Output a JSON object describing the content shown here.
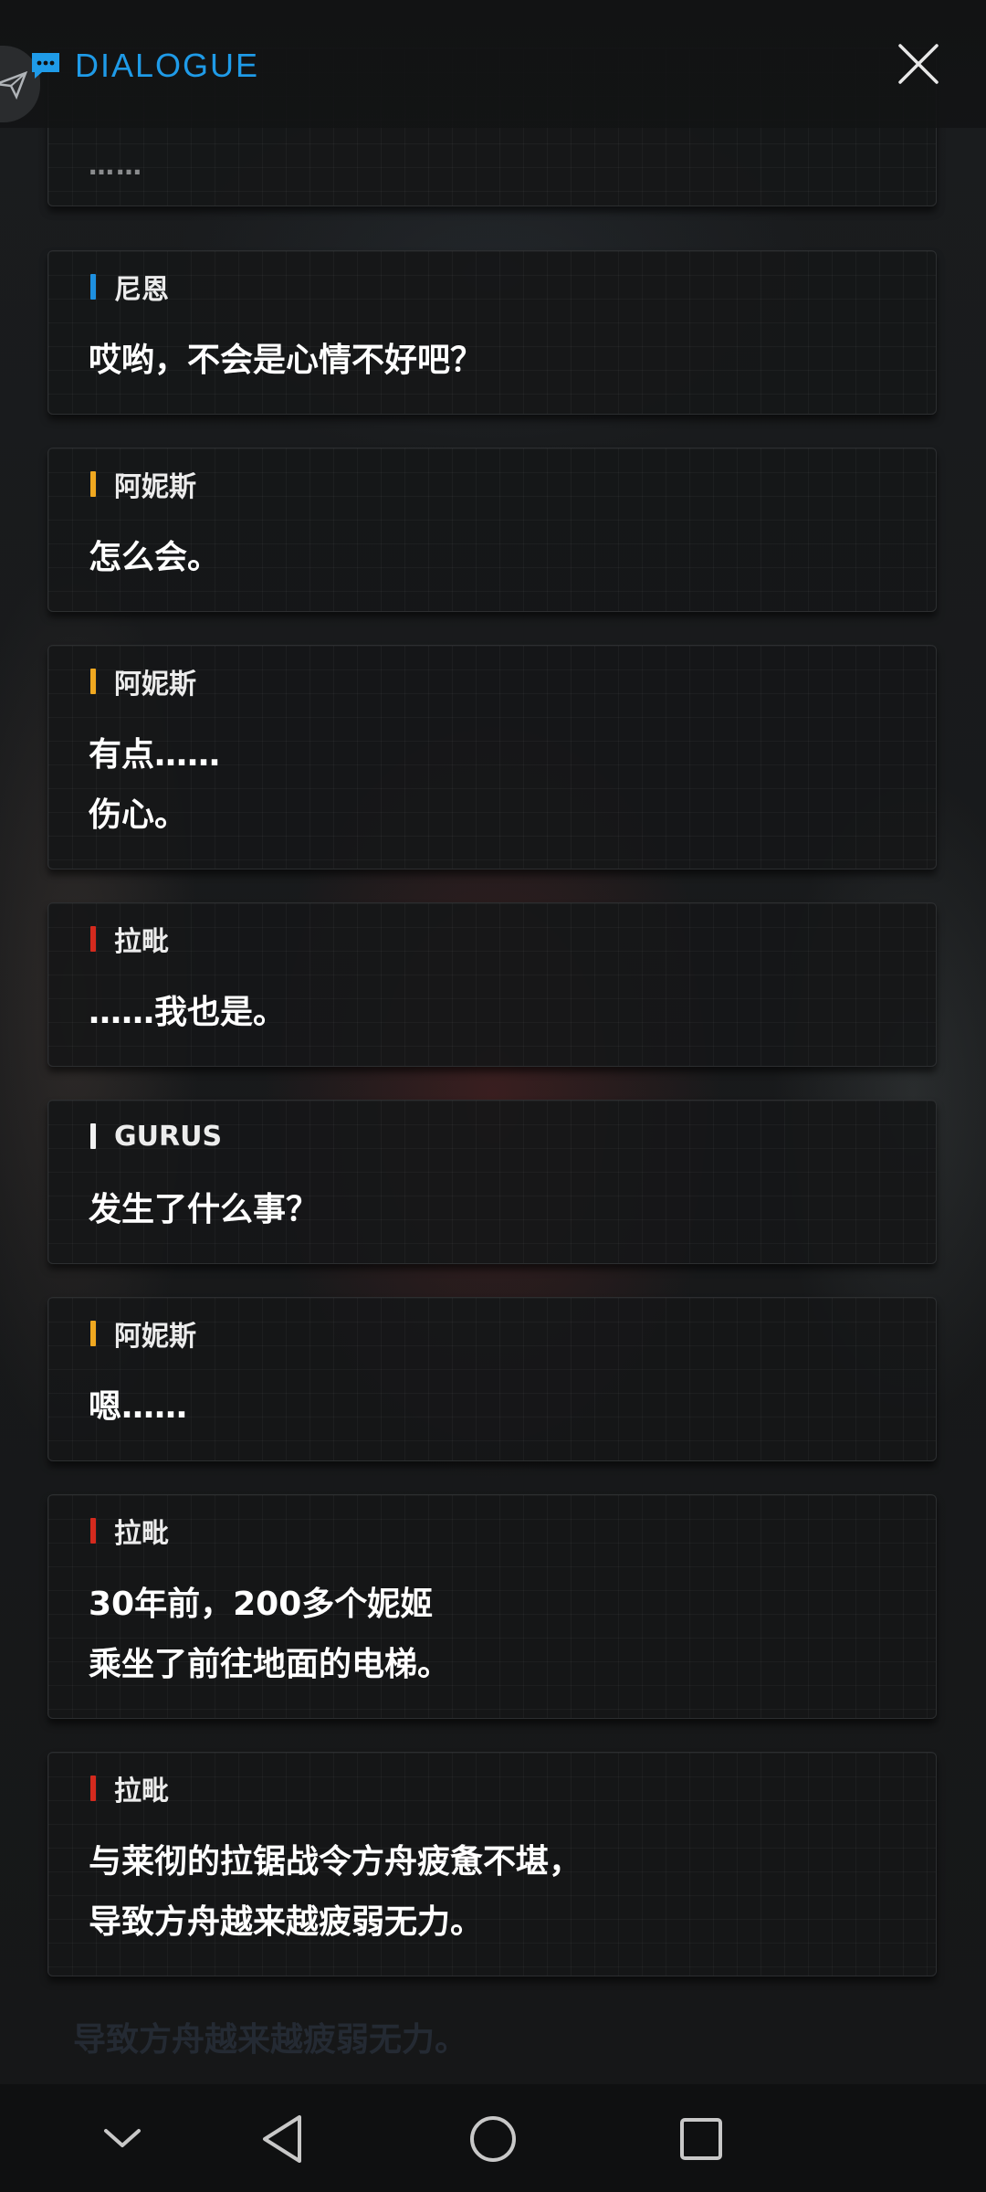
{
  "header": {
    "title": "DIALOGUE",
    "title_icon": "chat-bubble-icon",
    "close_icon": "close-icon",
    "accent_color": "#1f9be8"
  },
  "dialogue": {
    "partial_first_line": "……",
    "entries": [
      {
        "speaker": "尼恩",
        "speaker_color": "#1e90e0",
        "lines": [
          "哎哟，不会是心情不好吧？"
        ]
      },
      {
        "speaker": "阿妮斯",
        "speaker_color": "#f0a820",
        "lines": [
          "怎么会。"
        ]
      },
      {
        "speaker": "阿妮斯",
        "speaker_color": "#f0a820",
        "lines": [
          "有点……",
          "伤心。"
        ]
      },
      {
        "speaker": "拉毗",
        "speaker_color": "#d42a1e",
        "lines": [
          "……我也是。"
        ]
      },
      {
        "speaker": "GURUS",
        "speaker_color": "#f2f2f2",
        "lines": [
          "发生了什么事？"
        ]
      },
      {
        "speaker": "阿妮斯",
        "speaker_color": "#f0a820",
        "lines": [
          "嗯……"
        ]
      },
      {
        "speaker": "拉毗",
        "speaker_color": "#d42a1e",
        "lines": [
          "30年前，200多个妮姬",
          "乘坐了前往地面的电梯。"
        ]
      },
      {
        "speaker": "拉毗",
        "speaker_color": "#d42a1e",
        "lines": [
          "与莱彻的拉锯战令方舟疲惫不堪，",
          "导致方舟越来越疲弱无力。"
        ]
      }
    ]
  },
  "background_echo_text": "导致方舟越来越疲弱无力。",
  "navbar": {
    "buttons": [
      "chevron-down-icon",
      "back-triangle-icon",
      "home-circle-icon",
      "recents-square-icon"
    ]
  }
}
